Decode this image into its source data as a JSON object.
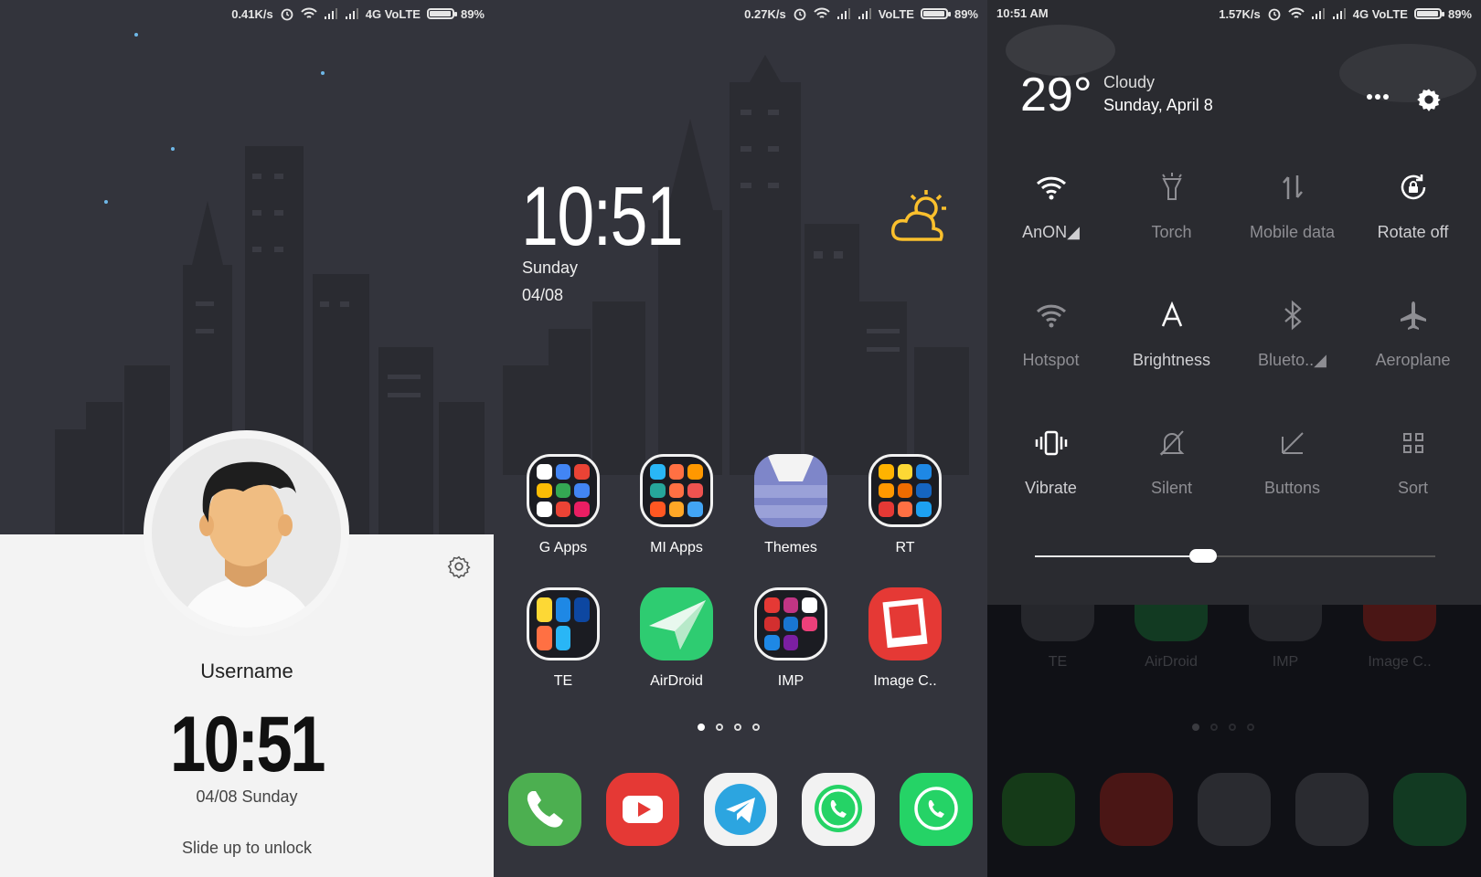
{
  "lock": {
    "status": {
      "speed": "0.41K/s",
      "network": "4G VoLTE",
      "battery": "89%"
    },
    "username": "Username",
    "time": "10:51",
    "date": "04/08 Sunday",
    "unlock_hint": "Slide up to unlock",
    "icons": [
      "alarm-icon",
      "wifi-icon",
      "signal-icon",
      "battery-icon",
      "moon-icon",
      "settings-gear-icon",
      "avatar-icon"
    ]
  },
  "home": {
    "status": {
      "speed": "0.27K/s",
      "network": "VoLTE",
      "battery": "89%"
    },
    "time": "10:51",
    "day": "Sunday",
    "date": "04/08",
    "apps_row1": [
      "G Apps",
      "MI Apps",
      "Themes",
      "RT"
    ],
    "apps_row2": [
      "TE",
      "AirDroid",
      "IMP",
      "Image C.."
    ],
    "page_indicator": {
      "pages": 4,
      "active": 1
    },
    "dock": [
      "phone",
      "youtube",
      "telegram",
      "whatsapp",
      "whatsapp"
    ]
  },
  "control": {
    "status": {
      "time": "10:51 AM",
      "speed": "1.57K/s",
      "network": "4G VoLTE",
      "battery": "89%"
    },
    "weather": {
      "temp": "29°",
      "condition": "Cloudy",
      "date": "Sunday, April 8"
    },
    "tiles": [
      {
        "label": "AnON◢",
        "icon": "wifi-icon",
        "on": true
      },
      {
        "label": "Torch",
        "icon": "torch-icon",
        "on": false
      },
      {
        "label": "Mobile data",
        "icon": "mobile-data-icon",
        "on": false
      },
      {
        "label": "Rotate off",
        "icon": "rotate-lock-icon",
        "on": true
      },
      {
        "label": "Hotspot",
        "icon": "hotspot-icon",
        "on": false
      },
      {
        "label": "Brightness",
        "icon": "brightness-auto-icon",
        "on": true
      },
      {
        "label": "Blueto..◢",
        "icon": "bluetooth-icon",
        "on": false
      },
      {
        "label": "Aeroplane",
        "icon": "airplane-icon",
        "on": false
      },
      {
        "label": "Vibrate",
        "icon": "vibrate-icon",
        "on": true
      },
      {
        "label": "Silent",
        "icon": "silent-icon",
        "on": false
      },
      {
        "label": "Buttons",
        "icon": "buttons-icon",
        "on": false
      },
      {
        "label": "Sort",
        "icon": "sort-grid-icon",
        "on": false
      }
    ],
    "brightness_level": 0.42,
    "dimmed_apps": [
      "TE",
      "AirDroid",
      "IMP",
      "Image C.."
    ]
  },
  "colors": {
    "moon": "#fbc02d",
    "phone": "#4caf50",
    "youtube": "#e53935",
    "telegram": "#2ca5e0",
    "whatsapp": "#25d366"
  }
}
